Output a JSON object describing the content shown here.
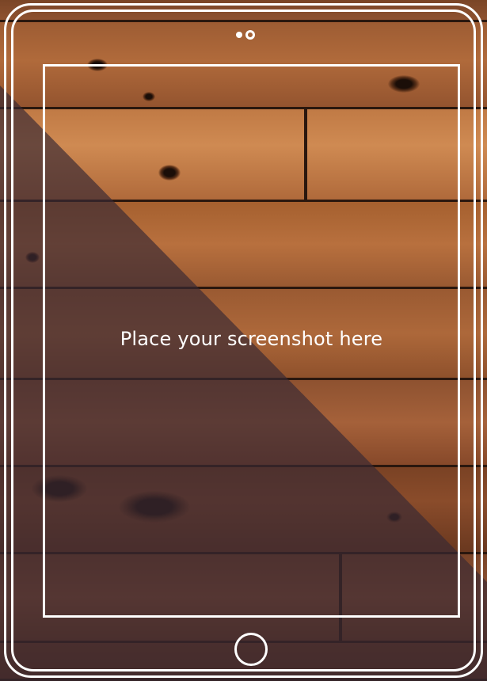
{
  "mockup": {
    "placeholder_text": "Place your screenshot here",
    "device": "tablet",
    "background": "wood-planks",
    "colors": {
      "frame": "#ffffff",
      "wood": "#9a5a32",
      "plank_gap": "#2a170e",
      "overlay": "#3a2a33"
    },
    "icons": {
      "camera": "camera-icon",
      "sensor": "sensor-icon",
      "home": "home-button-icon"
    }
  }
}
